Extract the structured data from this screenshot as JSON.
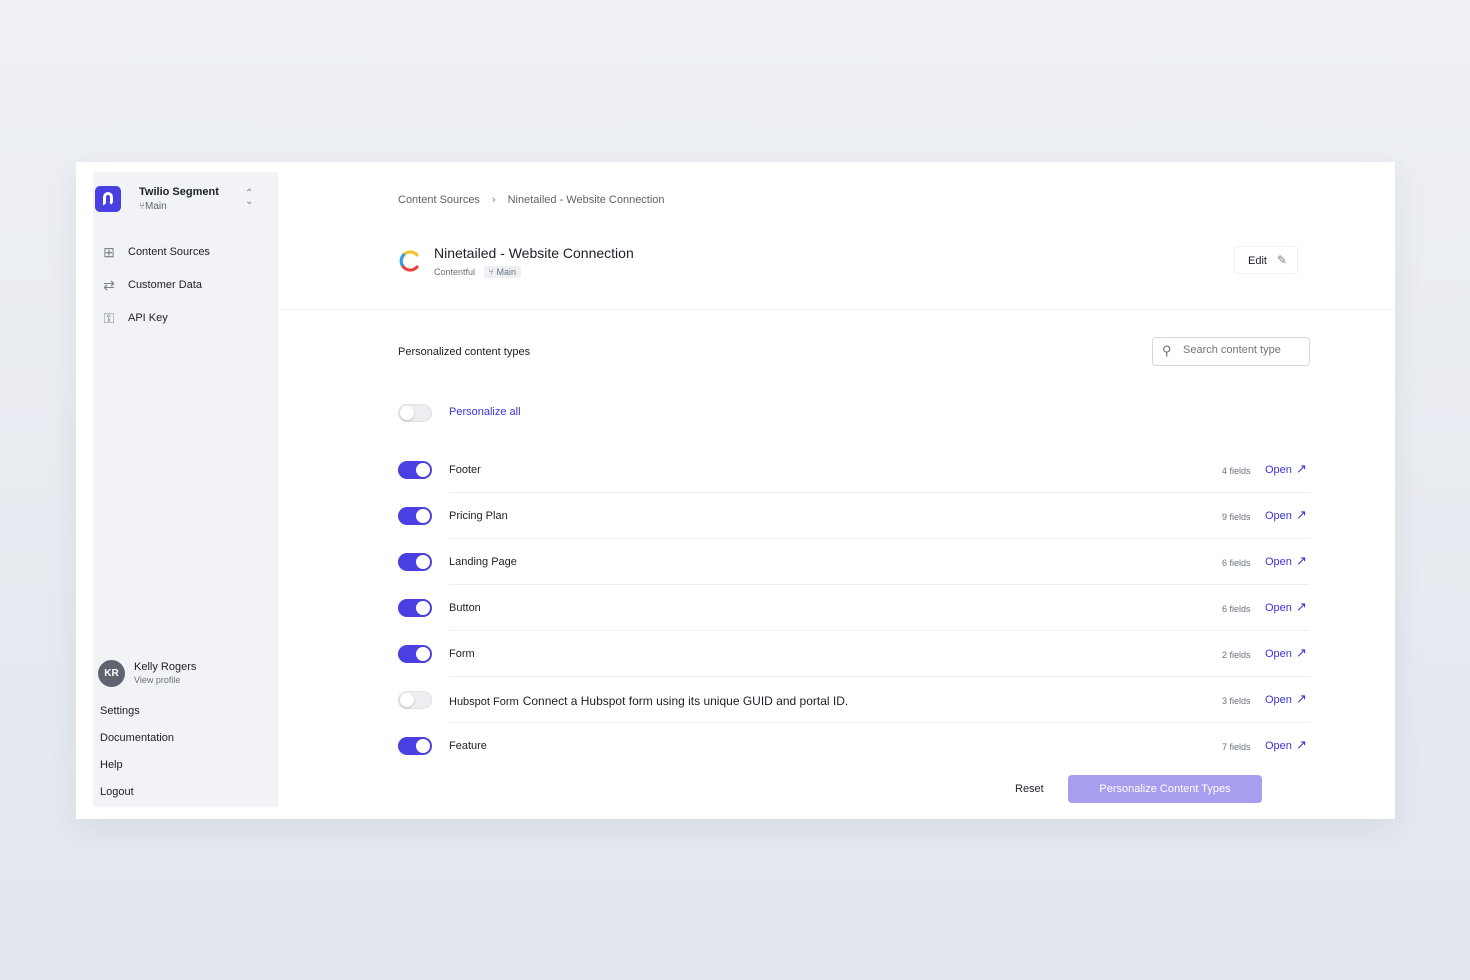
{
  "workspace": {
    "name": "Twilio Segment",
    "branch": "Main"
  },
  "sidebar": {
    "nav": [
      {
        "label": "Content Sources",
        "icon": "grid-icon"
      },
      {
        "label": "Customer Data",
        "icon": "swap-icon"
      },
      {
        "label": "API Key",
        "icon": "key-icon"
      }
    ],
    "profile": {
      "initials": "KR",
      "name": "Kelly Rogers",
      "subtitle": "View profile"
    },
    "links": [
      "Settings",
      "Documentation",
      "Help",
      "Logout"
    ]
  },
  "breadcrumb": {
    "parent": "Content Sources",
    "current": "Ninetailed - Website Connection"
  },
  "header": {
    "title": "Ninetailed - Website Connection",
    "source": "Contentful",
    "branch": "Main",
    "edit_label": "Edit"
  },
  "section": {
    "title": "Personalized content types",
    "search_placeholder": "Search content type"
  },
  "personalize_all": {
    "label": "Personalize all",
    "enabled": false
  },
  "content_types": [
    {
      "name": "Footer",
      "description": "",
      "fields": "4 fields",
      "enabled": true,
      "open": "Open"
    },
    {
      "name": "Pricing Plan",
      "description": "",
      "fields": "9 fields",
      "enabled": true,
      "open": "Open"
    },
    {
      "name": "Landing Page",
      "description": "",
      "fields": "6 fields",
      "enabled": true,
      "open": "Open"
    },
    {
      "name": "Button",
      "description": "",
      "fields": "6 fields",
      "enabled": true,
      "open": "Open"
    },
    {
      "name": "Form",
      "description": "",
      "fields": "2 fields",
      "enabled": true,
      "open": "Open"
    },
    {
      "name": "Hubspot Form",
      "description": "Connect a Hubspot form using its unique GUID and portal ID.",
      "fields": "3 fields",
      "enabled": false,
      "open": "Open"
    },
    {
      "name": "Feature",
      "description": "",
      "fields": "7 fields",
      "enabled": true,
      "open": "Open"
    }
  ],
  "actions": {
    "reset": "Reset",
    "primary": "Personalize Content Types"
  },
  "colors": {
    "accent": "#4a3fe0",
    "link": "#3c34d6",
    "primary_disabled": "#a79ef0"
  }
}
